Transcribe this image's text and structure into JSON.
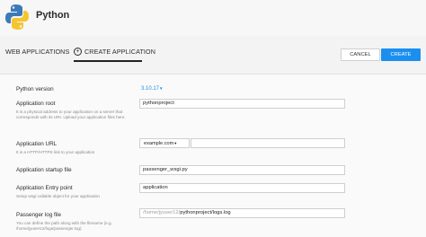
{
  "header": {
    "title": "Python"
  },
  "tabs": [
    {
      "label": "WEB APPLICATIONS"
    },
    {
      "label": "CREATE APPLICATION",
      "active": true
    }
  ],
  "actions": {
    "cancel_label": "CANCEL",
    "create_label": "CREATE"
  },
  "form": {
    "python_version": {
      "label": "Python version",
      "value": "3.10.17"
    },
    "app_root": {
      "label": "Application root",
      "help": "It is a physical address to your application on a server that corresponds with its URI. Upload your application files here.",
      "value": "pythonproject"
    },
    "app_url": {
      "label": "Application URL",
      "help": "It is a HTTP/HTTPS link to your application",
      "domain": "example.com",
      "path": ""
    },
    "startup_file": {
      "label": "Application startup file",
      "value": "passenger_wsgi.py"
    },
    "entry_point": {
      "label": "Application Entry point",
      "help": "Setup wsgi callable object for your application",
      "value": "application"
    },
    "log_file": {
      "label": "Passenger log file",
      "help": "You can define the path along with the filename (e.g. /home/jyuser12/logs/passenger.log)",
      "prefix": "/home/jyuser12/",
      "value": "pythonproject/logs.log"
    }
  },
  "colors": {
    "accent": "#1a8ff0",
    "background": "#f3f3f3"
  },
  "icons": {
    "logo": "python-logo-icon",
    "plus": "plus-circle-icon"
  }
}
